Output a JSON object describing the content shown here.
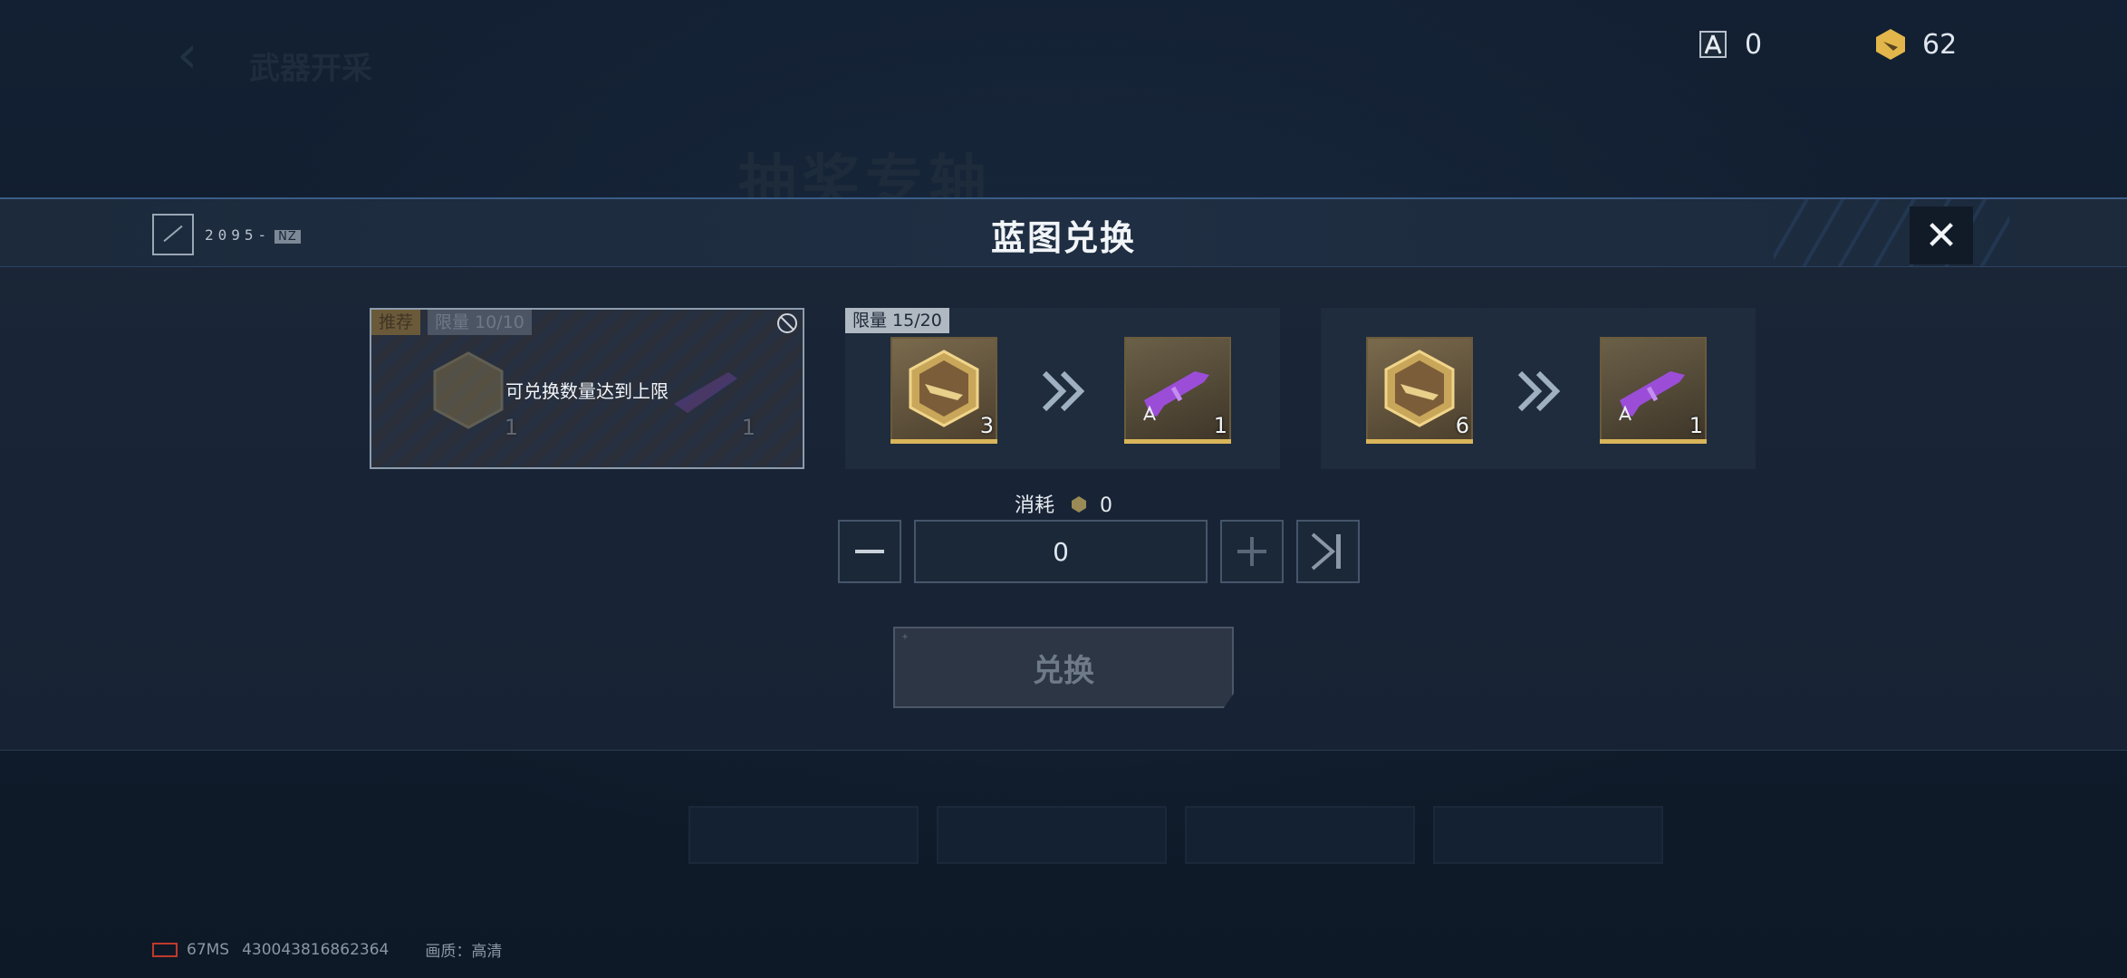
{
  "background": {
    "title": "抽奖专轴",
    "subtitle": "武器开采"
  },
  "currency": {
    "blueprint_value": "0",
    "hex_value": "62"
  },
  "modal": {
    "title": "蓝图兑换",
    "logo_text": "2095-",
    "logo_tag": "NZ",
    "close_label": "✕"
  },
  "cards": [
    {
      "tag_recommend": "推荐",
      "limit": "限量 10/10",
      "disabled_message": "可兑换数量达到上限",
      "input_count": "1",
      "output_count": "1"
    },
    {
      "limit": "限量 15/20",
      "input_count": "3",
      "output_count": "1"
    },
    {
      "limit": "",
      "input_count": "6",
      "output_count": "1"
    }
  ],
  "cost": {
    "label": "消耗",
    "value": "0"
  },
  "quantity": {
    "value": "0"
  },
  "exchange_button": {
    "label": "兑换"
  },
  "footer": {
    "ping": "67MS",
    "uid": "430043816862364",
    "quality": "画质：高清"
  },
  "colors": {
    "accent_gold": "#d9b55a",
    "accent_blue": "#3b5c86",
    "gun_purple": "#9b4dd8"
  }
}
